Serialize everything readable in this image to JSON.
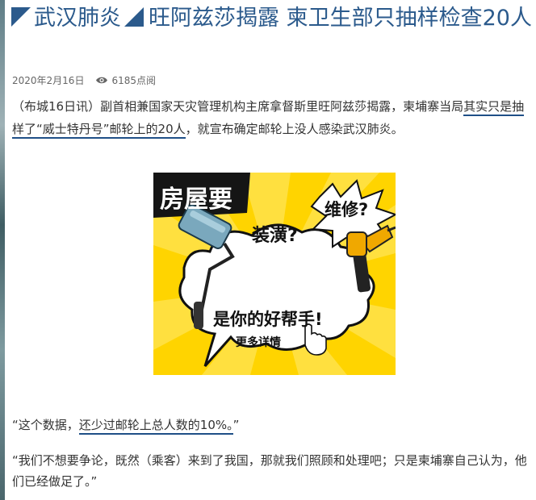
{
  "article": {
    "title_part1": "武汉肺炎",
    "title_part2": "旺阿兹莎揭露 柬卫生部只抽样检查20人",
    "date": "2020年2月16日",
    "views": "6185点阅",
    "para1_a": "（布城16日讯）副首相兼国家天灾管理机构主席拿督斯里旺阿兹莎揭露，柬埔寨当局",
    "para1_b": "其实只是抽样了“威士特丹号”邮轮上的20人",
    "para1_c": "，就宣布确定邮轮上没人感染武汉肺炎。",
    "quote1_a": "“这个数据，",
    "quote1_b": "还少过邮轮上总人数的10%。",
    "quote1_c": "”",
    "quote2": "“我们不想要争论，既然（乘客）来到了我国，那就我们照顾和处理吧；只是柬埔寨自己认为，他们已经做足了。”"
  },
  "ad": {
    "line1": "房屋要",
    "line2": "维修?",
    "line3": "装潢?",
    "line4": "是你的好帮手!",
    "cta": "更多详情",
    "background_color": "#ffd400"
  },
  "colors": {
    "headline": "#2b5a8c",
    "underline": "#1f4f87"
  }
}
